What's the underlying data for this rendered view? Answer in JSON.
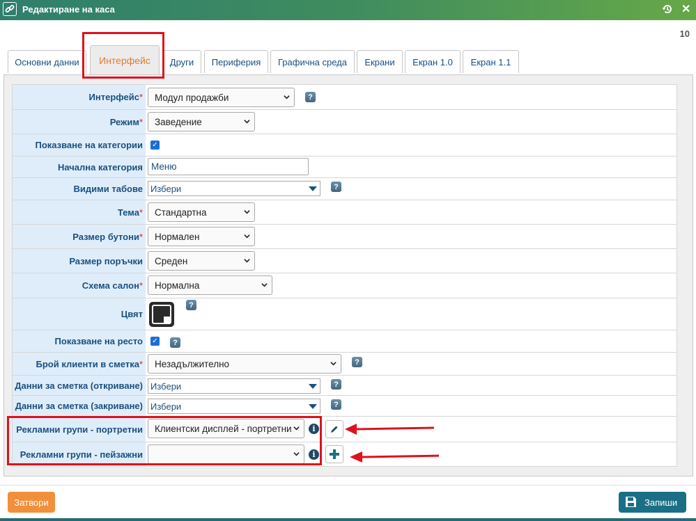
{
  "window": {
    "title": "Редактиране на каса",
    "record_id": "10"
  },
  "tabs": [
    {
      "label": "Основни данни"
    },
    {
      "label": "Интерфейс"
    },
    {
      "label": "Други"
    },
    {
      "label": "Периферия"
    },
    {
      "label": "Графична среда"
    },
    {
      "label": "Екрани"
    },
    {
      "label": "Екран 1.0"
    },
    {
      "label": "Екран 1.1"
    }
  ],
  "form": {
    "interface": {
      "label": "Интерфейс",
      "required": "*",
      "value": "Модул продажби"
    },
    "mode": {
      "label": "Режим",
      "required": "*",
      "value": "Заведение"
    },
    "show_categories": {
      "label": "Показване на категории",
      "checked": true
    },
    "start_category": {
      "label": "Начална категория",
      "value": "Меню"
    },
    "visible_tabs": {
      "label": "Видими табове",
      "value": "Избери"
    },
    "theme": {
      "label": "Тема",
      "required": "*",
      "value": "Стандартна"
    },
    "button_size": {
      "label": "Размер бутони",
      "required": "*",
      "value": "Нормален"
    },
    "order_size": {
      "label": "Размер поръчки",
      "value": "Среден"
    },
    "salon_scheme": {
      "label": "Схема салон",
      "required": "*",
      "value": "Нормална"
    },
    "color": {
      "label": "Цвят",
      "value": "#000000"
    },
    "show_change": {
      "label": "Показване на ресто",
      "checked": true
    },
    "clients_count": {
      "label": "Брой клиенти в сметка",
      "required": "*",
      "value": "Незадължително"
    },
    "bill_open": {
      "label": "Данни за сметка (откриване)",
      "value": "Избери"
    },
    "bill_close": {
      "label": "Данни за сметка (закриване)",
      "value": "Избери"
    },
    "ads_portrait": {
      "label": "Рекламни групи - портретни",
      "value": "Клиентски дисплей - портретни"
    },
    "ads_landscape": {
      "label": "Рекламни групи - пейзажни",
      "value": ""
    }
  },
  "help_glyph": "?",
  "info_glyph": "i",
  "footer": {
    "close_label": "Затвори",
    "save_label": "Запиши"
  },
  "colors": {
    "accent_orange": "#f28f3b",
    "accent_teal": "#1a6f86",
    "label_bg": "#dfedfa",
    "highlight_red": "#e0101c"
  }
}
